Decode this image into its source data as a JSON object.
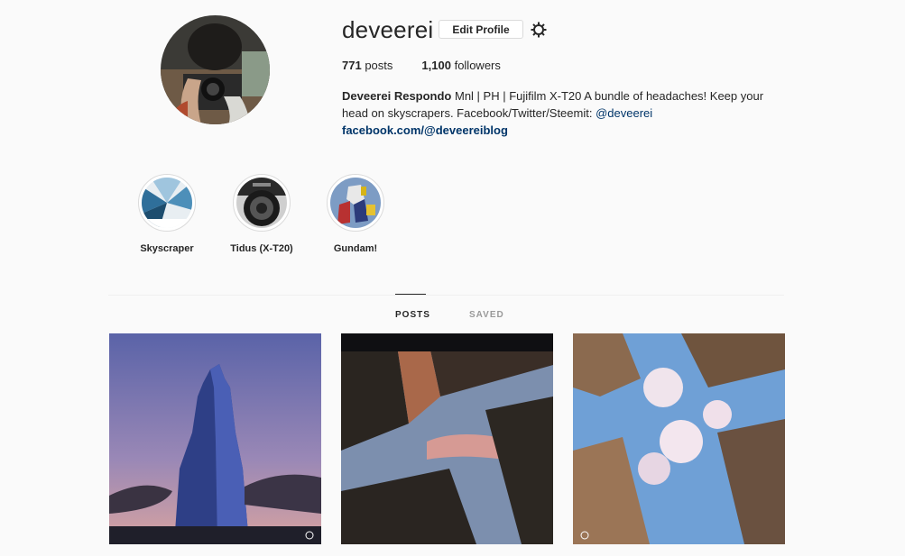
{
  "profile": {
    "username": "deveerei",
    "edit_label": "Edit Profile",
    "posts_count": "771",
    "posts_label": "posts",
    "followers_count": "1,100",
    "followers_label": "followers"
  },
  "bio": {
    "name": "Deveerei Respondo",
    "text": "Mnl | PH | Fujifilm X-T20 A bundle of headaches! Keep your head on skyscrapers. Facebook/Twitter/Steemit:",
    "mention": "@deveerei",
    "website": "facebook.com/@deveereiblog"
  },
  "highlights": [
    {
      "label": "Skyscraper"
    },
    {
      "label": "Tidus (X-T20)"
    },
    {
      "label": "Gundam!"
    }
  ],
  "tabs": [
    {
      "label": "POSTS"
    },
    {
      "label": "SAVED"
    }
  ],
  "colors": {
    "accent_link": "#003569",
    "text": "#262626",
    "muted": "#999999",
    "background": "#fafafa"
  },
  "icons": {
    "settings": "gear-icon",
    "post_badge": "video-badge-icon"
  }
}
